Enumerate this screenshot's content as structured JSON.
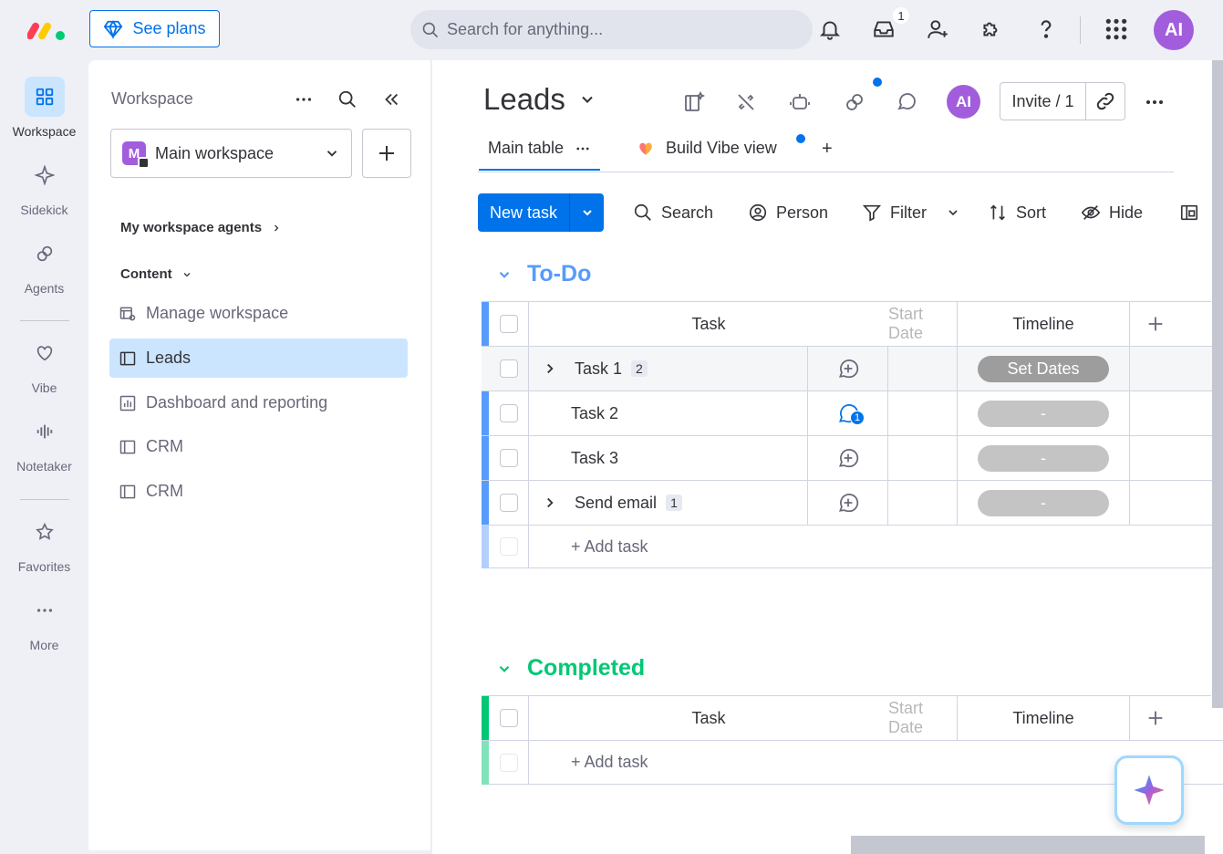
{
  "topbar": {
    "see_plans": "See plans",
    "search_placeholder": "Search for anything...",
    "inbox_count": "1",
    "avatar_initials": "AI"
  },
  "rail": {
    "items": [
      {
        "label": "Workspace",
        "icon": "grid-icon"
      },
      {
        "label": "Sidekick",
        "icon": "sparkle-icon"
      },
      {
        "label": "Agents",
        "icon": "agents-icon"
      },
      {
        "label": "Vibe",
        "icon": "heart-icon"
      },
      {
        "label": "Notetaker",
        "icon": "soundwave-icon"
      },
      {
        "label": "Favorites",
        "icon": "star-icon"
      },
      {
        "label": "More",
        "icon": "more-dots-icon"
      }
    ]
  },
  "sidebar": {
    "title": "Workspace",
    "workspace_name": "Main workspace",
    "workspace_initial": "M",
    "agents_label": "My workspace agents",
    "content_label": "Content",
    "nav": [
      {
        "label": "Manage workspace"
      },
      {
        "label": "Leads"
      },
      {
        "label": "Dashboard and reporting"
      },
      {
        "label": "CRM"
      },
      {
        "label": "CRM"
      }
    ]
  },
  "board": {
    "title": "Leads",
    "invite_label": "Invite / 1",
    "avatar_initials": "AI",
    "tabs": [
      {
        "label": "Main table"
      },
      {
        "label": "Build Vibe view"
      }
    ],
    "add_tab": "+",
    "toolbar": {
      "new_task": "New task",
      "search": "Search",
      "person": "Person",
      "filter": "Filter",
      "sort": "Sort",
      "hide": "Hide"
    },
    "colors": {
      "primary": "#0073ea",
      "todo": "#579bfc",
      "done": "#00c875"
    }
  },
  "groups": [
    {
      "title": "To-Do",
      "columns": {
        "task": "Task",
        "start_date": "Start Date",
        "timeline": "Timeline"
      },
      "rows": [
        {
          "task": "Task 1",
          "subitems": "2",
          "timeline": "Set Dates",
          "updates": ""
        },
        {
          "task": "Task 2",
          "subitems": "",
          "timeline": "-",
          "updates": "1"
        },
        {
          "task": "Task 3",
          "subitems": "",
          "timeline": "-",
          "updates": ""
        },
        {
          "task": "Send email",
          "subitems": "1",
          "timeline": "-",
          "updates": ""
        }
      ],
      "add_task": "+ Add task"
    },
    {
      "title": "Completed",
      "columns": {
        "task": "Task",
        "start_date": "Start Date",
        "timeline": "Timeline"
      },
      "rows": [],
      "add_task": "+ Add task"
    }
  ]
}
